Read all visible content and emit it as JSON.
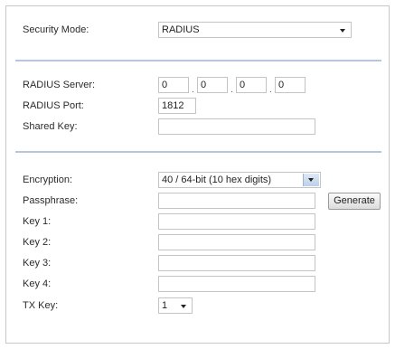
{
  "security": {
    "label": "Security Mode:",
    "value": "RADIUS"
  },
  "radius": {
    "server_label": "RADIUS Server:",
    "server_octets": [
      "0",
      "0",
      "0",
      "0"
    ],
    "port_label": "RADIUS Port:",
    "port_value": "1812",
    "shared_key_label": "Shared Key:",
    "shared_key_value": ""
  },
  "wep": {
    "encryption_label": "Encryption:",
    "encryption_value": "40 / 64-bit (10 hex digits)",
    "passphrase_label": "Passphrase:",
    "passphrase_value": "",
    "generate_label": "Generate",
    "key1_label": "Key 1:",
    "key2_label": "Key 2:",
    "key3_label": "Key 3:",
    "key4_label": "Key 4:",
    "txkey_label": "TX Key:",
    "txkey_value": "1"
  }
}
